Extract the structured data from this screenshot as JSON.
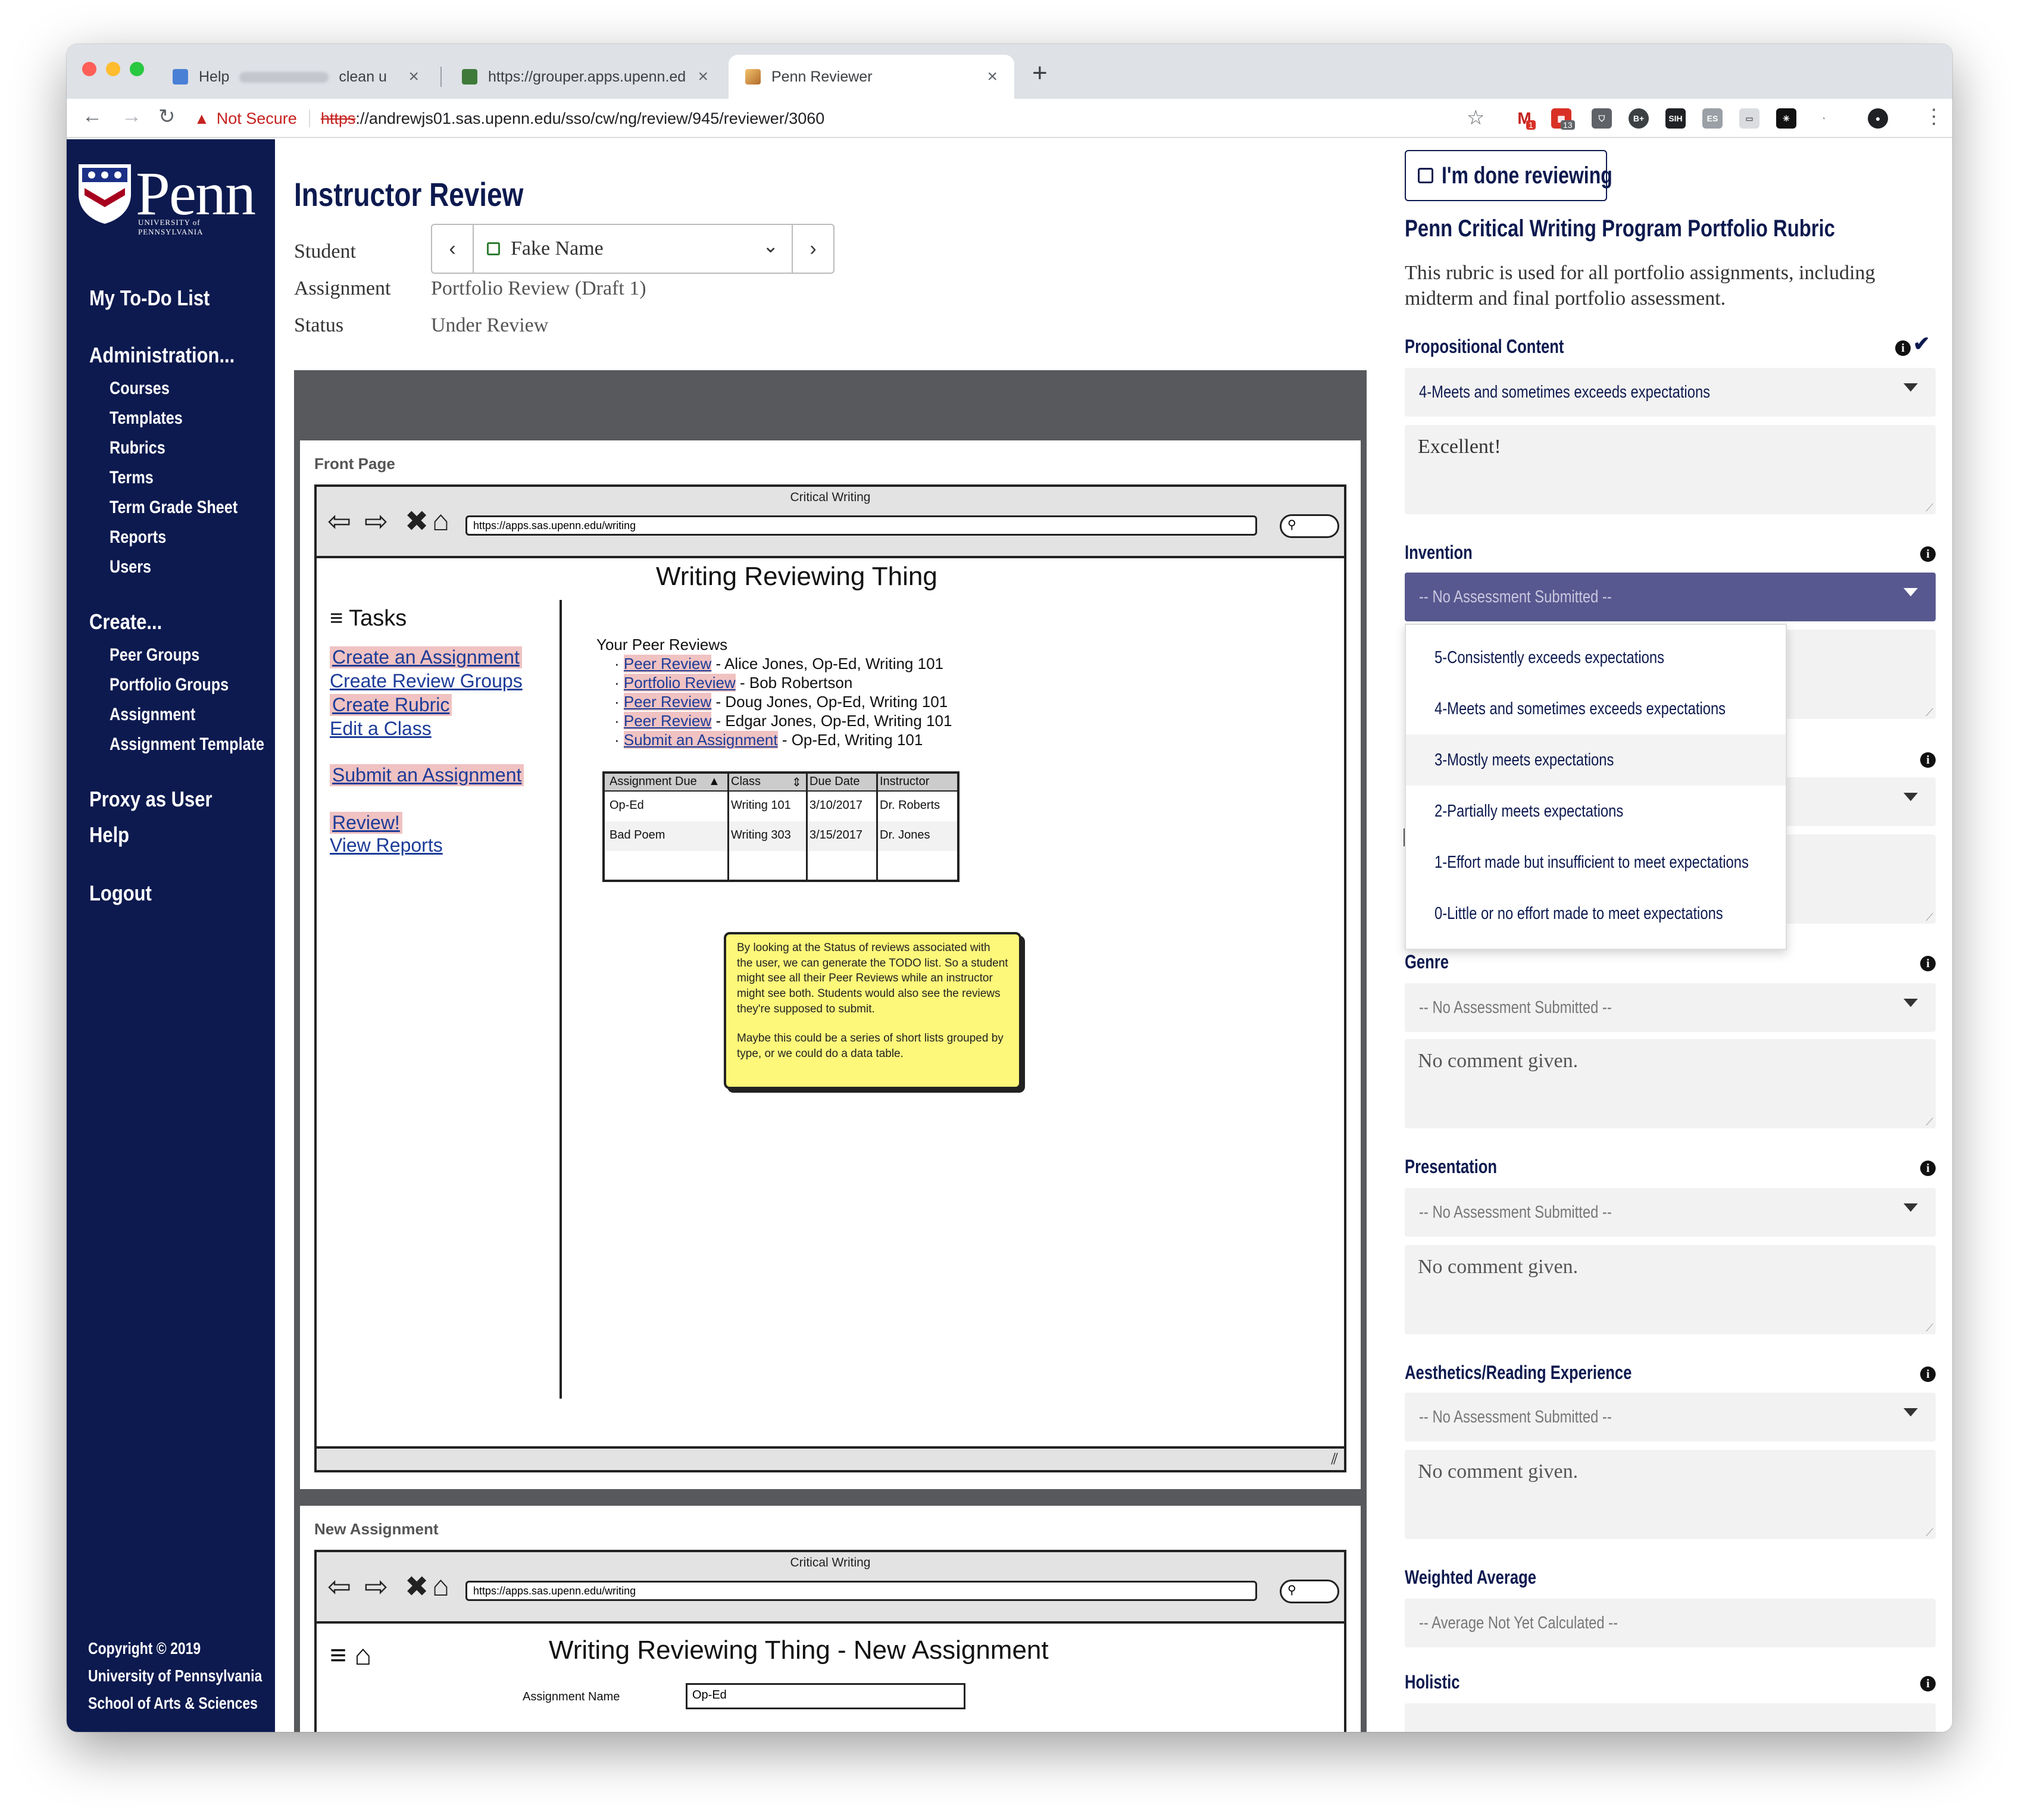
{
  "browser": {
    "tabs": [
      {
        "label": "Help",
        "extra": "clean u"
      },
      {
        "label": "https://grouper.apps.upenn.ed"
      },
      {
        "label": "Penn Reviewer"
      }
    ],
    "new_tab": "+",
    "not_secure": "Not Secure",
    "url_scheme": "https",
    "url_rest": "://andrewjs01.sas.upenn.edu/sso/cw/ng/review/945/reviewer/3060",
    "ext_badges": [
      "1",
      "13"
    ]
  },
  "sidebar": {
    "logo_text": "Penn",
    "logo_sub": "UNIVERSITY of PENNSYLVANIA",
    "todo": "My To-Do List",
    "admin": {
      "label": "Administration...",
      "items": [
        "Courses",
        "Templates",
        "Rubrics",
        "Terms",
        "Term Grade Sheet",
        "Reports",
        "Users"
      ]
    },
    "create": {
      "label": "Create...",
      "items": [
        "Peer Groups",
        "Portfolio Groups",
        "Assignment",
        "Assignment Template"
      ]
    },
    "proxy": "Proxy as User",
    "help": "Help",
    "logout": "Logout",
    "copyright": [
      "Copyright © 2019",
      "University of Pennsylvania",
      "School of Arts & Sciences"
    ]
  },
  "review": {
    "title": "Instructor Review",
    "student_label": "Student",
    "student_name": "Fake Name",
    "assignment_label": "Assignment",
    "assignment_value": "Portfolio Review (Draft 1)",
    "status_label": "Status",
    "status_value": "Under Review"
  },
  "document": {
    "page1": {
      "label": "Front Page",
      "window_title": "Critical Writing",
      "url": "https://apps.sas.upenn.edu/writing",
      "heading": "Writing Reviewing Thing",
      "tasks_label": "Tasks",
      "task_links": [
        "Create an Assignment",
        "Create Review Groups",
        "Create Rubric",
        "Edit a Class",
        "Submit an Assignment",
        "Review!",
        "View Reports"
      ],
      "peer_heading": "Your Peer Reviews",
      "peer_items": [
        {
          "link": "Peer Review",
          "rest": " - Alice Jones, Op-Ed, Writing 101"
        },
        {
          "link": "Portfolio Review",
          "rest": " - Bob Robertson"
        },
        {
          "link": "Peer Review",
          "rest": " - Doug Jones, Op-Ed, Writing 101"
        },
        {
          "link": "Peer Review",
          "rest": " - Edgar Jones, Op-Ed, Writing 101"
        },
        {
          "link": "Submit an Assignment",
          "rest": " - Op-Ed, Writing 101"
        }
      ],
      "table": {
        "headers": [
          "Assignment Due",
          "Class",
          "Due Date",
          "Instructor"
        ],
        "rows": [
          [
            "Op-Ed",
            "Writing 101",
            "3/10/2017",
            "Dr. Roberts"
          ],
          [
            "Bad Poem",
            "Writing 303",
            "3/15/2017",
            "Dr. Jones"
          ]
        ]
      },
      "note": [
        "By looking at the Status of reviews associated with the user, we can generate the TODO list. So a student might see all their Peer Reviews while an instructor might see both.  Students would also see the reviews they're supposed to submit.",
        "Maybe this could be a series of short lists grouped by type, or we could do a data table."
      ]
    },
    "page2": {
      "label": "New Assignment",
      "window_title": "Critical Writing",
      "url": "https://apps.sas.upenn.edu/writing",
      "heading": "Writing Reviewing Thing - New Assignment",
      "field_label": "Assignment Name",
      "field_value": "Op-Ed"
    }
  },
  "rubric": {
    "done_label": "I'm done reviewing",
    "title": "Penn Critical Writing Program Portfolio Rubric",
    "description": "This rubric is used for all portfolio assignments, including midterm and final portfolio assessment.",
    "criteria": [
      {
        "label": "Propositional Content",
        "selected": "4-Meets and sometimes exceeds expectations",
        "comment": "Excellent!"
      },
      {
        "label": "Invention",
        "selected": "-- No Assessment Submitted --"
      },
      {
        "label": "Genre",
        "selected": "-- No Assessment Submitted --",
        "comment": "No comment given."
      },
      {
        "label": "Presentation",
        "selected": "-- No Assessment Submitted --",
        "comment": "No comment given."
      },
      {
        "label": "Aesthetics/Reading Experience",
        "selected": "-- No Assessment Submitted --",
        "comment": "No comment given."
      }
    ],
    "dropdown_options": [
      "5-Consistently exceeds expectations",
      "4-Meets and sometimes exceeds expectations",
      "3-Mostly meets expectations",
      "2-Partially meets expectations",
      "1-Effort made but insufficient to meet expectations",
      "0-Little or no effort made to meet expectations"
    ],
    "weighted_label": "Weighted Average",
    "weighted_value": "-- Average Not Yet Calculated --",
    "holistic_label": "Holistic"
  },
  "colors": {
    "navy": "#0d1a4f",
    "sidebar_bg": "#0d1a4f",
    "open_select": "#585890",
    "highlight": "#f0c2c2",
    "sticky": "#fdf77a",
    "warning_red": "#c5221f"
  }
}
